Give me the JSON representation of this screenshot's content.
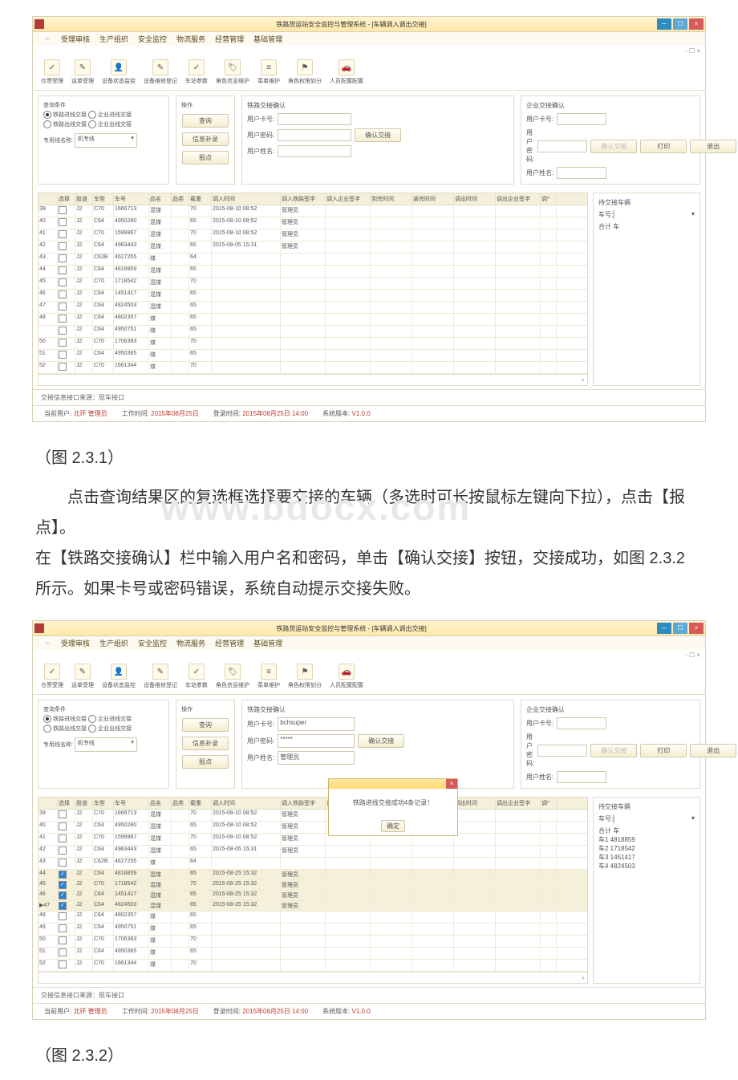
{
  "window": {
    "title": "铁路货运站安全监控与管理系统 - [车辆调入调出交接]",
    "mdi_controls": "- ☐ ×"
  },
  "menus": {
    "arrow": "←",
    "m1": "受理审核",
    "m2": "生产组织",
    "m3": "安全监控",
    "m4": "物流服务",
    "m5": "经营管理",
    "m6": "基础管理"
  },
  "toolbar": {
    "t1": "仓票受理",
    "t2": "运单受理",
    "t3": "设备状态监控",
    "t4": "设备维修登记",
    "t5": "车站参数",
    "t6": "角色信息维护",
    "t7": "菜单维护",
    "t8": "角色权限划分",
    "t9": "人员配置配置"
  },
  "query": {
    "section": "查询条件",
    "r1": "铁路进线交接",
    "r2": "企业进线交接",
    "r3": "铁路出线交接",
    "r4": "企业出线交接",
    "dedicated_label": "专用线名称:",
    "dedicated_value": "机专线"
  },
  "ops": {
    "section": "操作",
    "query": "查询",
    "supp": "信息补录",
    "report": "报点"
  },
  "rail": {
    "section": "铁路交接确认",
    "card_label": "用户卡号:",
    "card_value_2": "bchsuper",
    "pwd_label": "用户密码:",
    "pwd_value_2": "*****",
    "name_label": "用户姓名:",
    "name_value_2": "管理员",
    "confirm": "确认交接"
  },
  "ent": {
    "section": "企业交接确认",
    "card_label": "用户卡号:",
    "pwd_label": "用户密码:",
    "name_label": "用户姓名:",
    "confirm": "确认交接",
    "print": "打印",
    "exit": "退出"
  },
  "cols": {
    "c0": "",
    "c1": "选择",
    "c2": "股道",
    "c3": "车型",
    "c4": "车号",
    "c5": "品名",
    "c6": "品类",
    "c7": "载重",
    "c8": "调入时间",
    "c9": "调入铁路签字",
    "c10": "调入企业签字",
    "c11": "到完时间",
    "c12": "装完时间",
    "c13": "调出时间",
    "c14": "调出企业签字",
    "c15": "调^"
  },
  "rows": [
    {
      "n": "39",
      "g": "J2",
      "t": "C70",
      "no": "1666713",
      "p": "混煤",
      "l": "70",
      "time": "2015-08-10 08:52",
      "sig": "管理员"
    },
    {
      "n": "40",
      "g": "J2",
      "t": "C64",
      "no": "4950280",
      "p": "混煤",
      "l": "65",
      "time": "2015-08-10 08:52",
      "sig": "管理员"
    },
    {
      "n": "41",
      "g": "J2",
      "t": "C70",
      "no": "1599967",
      "p": "混煤",
      "l": "70",
      "time": "2015-08-10 08:52",
      "sig": "管理员"
    },
    {
      "n": "42",
      "g": "J2",
      "t": "C64",
      "no": "4963443",
      "p": "混煤",
      "l": "65",
      "time": "2015-08-05 15:31",
      "sig": "管理员"
    },
    {
      "n": "43",
      "g": "J2",
      "t": "C62B",
      "no": "4627255",
      "p": "煤",
      "l": "64",
      "time": "",
      "sig": ""
    },
    {
      "n": "44",
      "g": "J2",
      "t": "C64",
      "no": "4818859",
      "p": "混煤",
      "l": "65",
      "time": "",
      "sig": ""
    },
    {
      "n": "45",
      "g": "J2",
      "t": "C70",
      "no": "1718542",
      "p": "混煤",
      "l": "70",
      "time": "",
      "sig": ""
    },
    {
      "n": "46",
      "g": "J2",
      "t": "C64",
      "no": "1451417",
      "p": "混煤",
      "l": "65",
      "time": "",
      "sig": ""
    },
    {
      "n": "47",
      "g": "J2",
      "t": "C64",
      "no": "4824503",
      "p": "混煤",
      "l": "65",
      "time": "",
      "sig": ""
    },
    {
      "n": "48",
      "g": "J2",
      "t": "C64",
      "no": "4802357",
      "p": "煤",
      "l": "65",
      "time": "",
      "sig": ""
    },
    {
      "n": "",
      "g": "J2",
      "t": "C64",
      "no": "4950751",
      "p": "煤",
      "l": "65",
      "time": "",
      "sig": ""
    },
    {
      "n": "50",
      "g": "J2",
      "t": "C70",
      "no": "1706383",
      "p": "煤",
      "l": "70",
      "time": "",
      "sig": ""
    },
    {
      "n": "51",
      "g": "J2",
      "t": "C64",
      "no": "4950365",
      "p": "煤",
      "l": "65",
      "time": "",
      "sig": ""
    },
    {
      "n": "52",
      "g": "J2",
      "t": "C70",
      "no": "1661344",
      "p": "煤",
      "l": "70",
      "time": "",
      "sig": ""
    }
  ],
  "rows2": [
    {
      "n": "39",
      "ck": false,
      "g": "J2",
      "t": "C70",
      "no": "1666713",
      "p": "混煤",
      "l": "70",
      "time": "2015-08-10 08:52",
      "sig": "管理员"
    },
    {
      "n": "40",
      "ck": false,
      "g": "J2",
      "t": "C64",
      "no": "4950280",
      "p": "混煤",
      "l": "65",
      "time": "2015-08-10 08:52",
      "sig": "管理员"
    },
    {
      "n": "41",
      "ck": false,
      "g": "J2",
      "t": "C70",
      "no": "1599967",
      "p": "混煤",
      "l": "70",
      "time": "2015-08-10 08:52",
      "sig": "管理员"
    },
    {
      "n": "42",
      "ck": false,
      "g": "J2",
      "t": "C64",
      "no": "4963443",
      "p": "混煤",
      "l": "65",
      "time": "2015-08-05 15:31",
      "sig": "管理员"
    },
    {
      "n": "43",
      "ck": false,
      "g": "J2",
      "t": "C62B",
      "no": "4627255",
      "p": "煤",
      "l": "64",
      "time": "",
      "sig": ""
    },
    {
      "n": "44",
      "ck": true,
      "g": "J2",
      "t": "C64",
      "no": "4818859",
      "p": "混煤",
      "l": "65",
      "time": "2015-08-25 15:32",
      "sig": "管理员"
    },
    {
      "n": "45",
      "ck": true,
      "g": "J2",
      "t": "C70",
      "no": "1718542",
      "p": "混煤",
      "l": "70",
      "time": "2015-08-25 15:32",
      "sig": "管理员"
    },
    {
      "n": "46",
      "ck": true,
      "g": "J2",
      "t": "C64",
      "no": "1451417",
      "p": "混煤",
      "l": "65",
      "time": "2015-08-25 15:32",
      "sig": "管理员"
    },
    {
      "n": "▶47",
      "ck": true,
      "g": "J2",
      "t": "C64",
      "no": "4824503",
      "p": "混煤",
      "l": "65",
      "time": "2015-08-25 15:32",
      "sig": "管理员"
    },
    {
      "n": "48",
      "ck": false,
      "g": "J2",
      "t": "C64",
      "no": "4802357",
      "p": "煤",
      "l": "65",
      "time": "",
      "sig": ""
    },
    {
      "n": "49",
      "ck": false,
      "g": "J2",
      "t": "C64",
      "no": "4950751",
      "p": "煤",
      "l": "65",
      "time": "",
      "sig": ""
    },
    {
      "n": "50",
      "ck": false,
      "g": "J2",
      "t": "C70",
      "no": "1706383",
      "p": "煤",
      "l": "70",
      "time": "",
      "sig": ""
    },
    {
      "n": "51",
      "ck": false,
      "g": "J2",
      "t": "C64",
      "no": "4950365",
      "p": "煤",
      "l": "65",
      "time": "",
      "sig": ""
    },
    {
      "n": "52",
      "ck": false,
      "g": "J2",
      "t": "C70",
      "no": "1661344",
      "p": "煤",
      "l": "70",
      "time": "",
      "sig": ""
    }
  ],
  "side": {
    "title": "待交接车辆",
    "carno_label": "车号:",
    "total": "合计        车",
    "items": [
      "车1 4818859",
      "车2 1718542",
      "车3 1451417",
      "车4 4824503"
    ]
  },
  "modal": {
    "msg": "铁路进线交接成功4条记录！",
    "ok": "确定"
  },
  "footer_src": "交接信息接口来源：现车接口",
  "status": {
    "user_l": "当前用户:",
    "user_v": "北环 管理员",
    "time_l": "工作时间:",
    "time_v": "2015年08月25日",
    "login_l": "登录时间:",
    "login_v": "2015年08月25日 14:00",
    "ver_l": "系统版本:",
    "ver_v": "V1.0.0"
  },
  "doc": {
    "cap1": "（图 2.3.1）",
    "p1": "　　点击查询结果区的复选框选择要交接的车辆（多选时可长按鼠标左键向下拉），点击【报点】。",
    "p2": "在【铁路交接确认】栏中输入用户名和密码，单击【确认交接】按钮，交接成功，如图 2.3.2 所示。如果卡号或密码错误，系统自动提示交接失败。",
    "cap2": "（图 2.3.2）",
    "watermark": "www.bdocx.com"
  }
}
